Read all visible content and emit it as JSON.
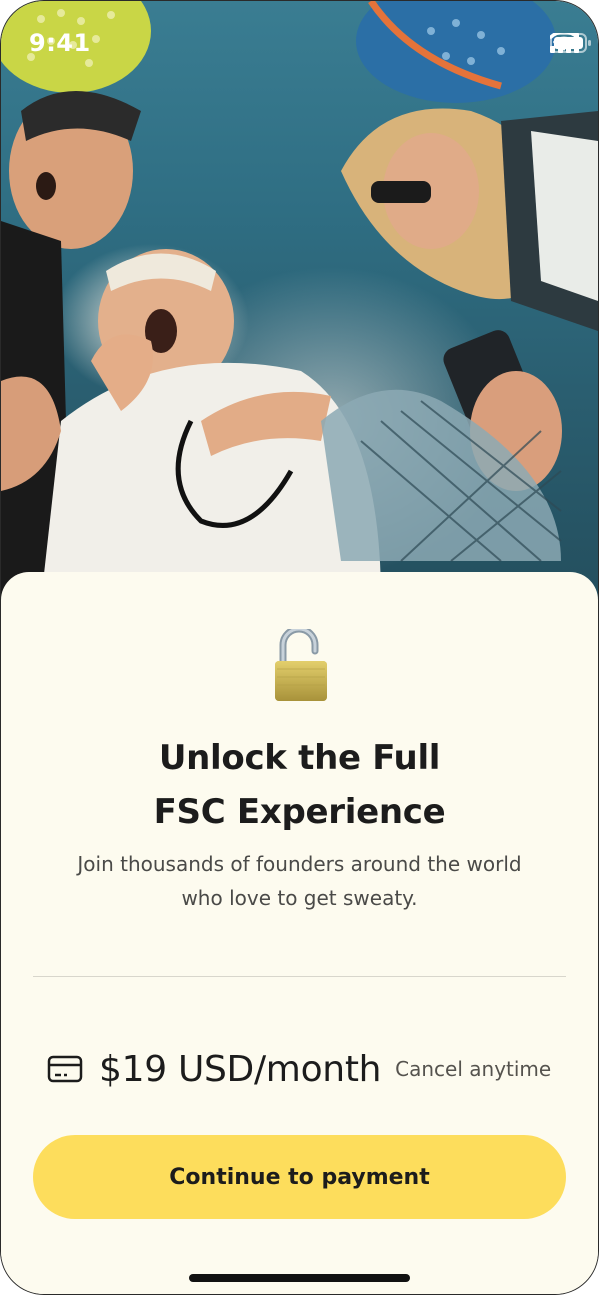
{
  "status_bar": {
    "time": "9:41",
    "icons": [
      "signal-icon",
      "wifi-icon",
      "battery-icon"
    ]
  },
  "hero": {
    "image": "photo of four people with padel rackets looking down at the camera"
  },
  "paywall": {
    "icon": "unlocked-padlock-icon",
    "title_line1": "Unlock the Full",
    "title_line2": "FSC Experience",
    "subtitle_line1": "Join thousands of founders around the world",
    "subtitle_line2": "who love to get sweaty.",
    "price_icon": "credit-card-icon",
    "price": "$19 USD/month",
    "cancel_note": "Cancel anytime",
    "cta_label": "Continue to payment"
  },
  "colors": {
    "sheet_background": "#fdfbef",
    "cta_background": "#fddd5c",
    "text_primary": "#1c1c1c",
    "text_secondary": "#4a4a48"
  }
}
